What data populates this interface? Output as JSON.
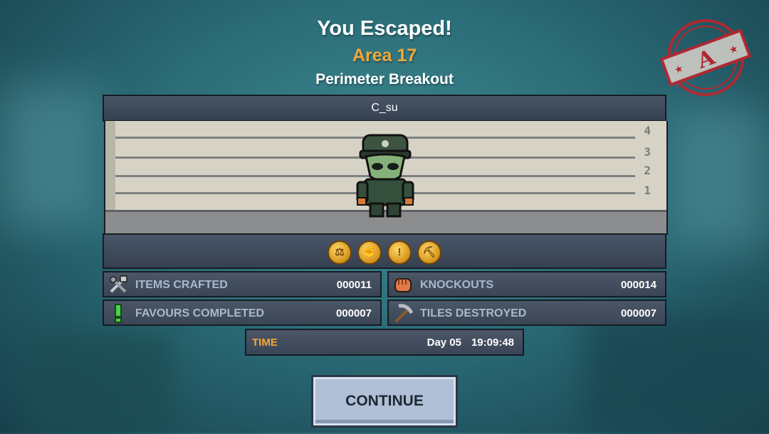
{
  "header": {
    "title": "You Escaped!",
    "area": "Area 17",
    "subtitle": "Perimeter Breakout"
  },
  "player": {
    "name": "C_su"
  },
  "height_chart": {
    "marks": [
      "4",
      "3",
      "2",
      "1"
    ]
  },
  "medals": [
    "scales-icon",
    "fist-icon",
    "exclamation-icon",
    "pickaxe-icon"
  ],
  "stats": [
    {
      "label": "ITEMS CRAFTED",
      "value": "000011",
      "icon": "tools-icon"
    },
    {
      "label": "KNOCKOUTS",
      "value": "000014",
      "icon": "fist-icon"
    },
    {
      "label": "FAVOURS COMPLETED",
      "value": "000007",
      "icon": "exclamation-icon"
    },
    {
      "label": "TILES DESTROYED",
      "value": "000007",
      "icon": "pickaxe-icon"
    }
  ],
  "time": {
    "label": "TIME",
    "day": "Day 05",
    "clock": "19:09:48"
  },
  "continue_label": "CONTINUE",
  "grade": "A",
  "colors": {
    "accent": "#f0a83a",
    "panel": "#3b4656",
    "stamp": "#c8202a"
  }
}
